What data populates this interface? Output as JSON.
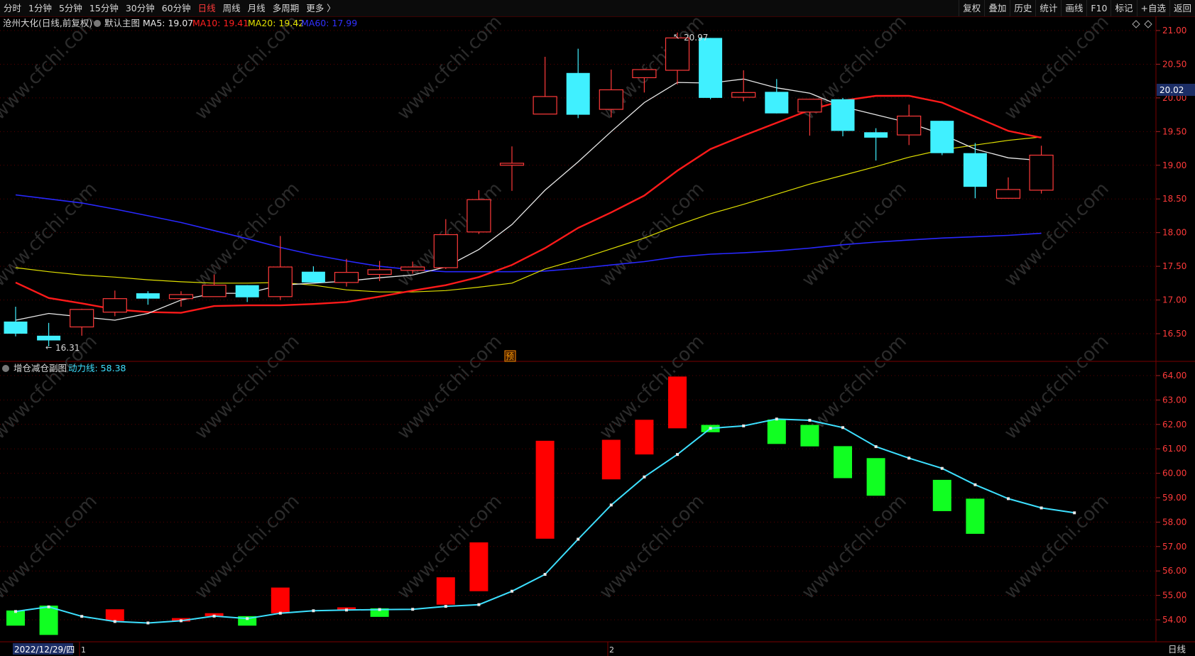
{
  "toolbar": {
    "periods": [
      "分时",
      "1分钟",
      "5分钟",
      "15分钟",
      "30分钟",
      "60分钟",
      "日线",
      "周线",
      "月线",
      "多周期",
      "更多 〉"
    ],
    "active_index": 6,
    "right_buttons": [
      "复权",
      "叠加",
      "历史",
      "统计",
      "画线",
      "F10",
      "标记",
      "+自选",
      "返回"
    ]
  },
  "main_chart": {
    "stock_title": "沧州大化(日线,前复权)",
    "indicator_name": "默认主图",
    "ma": [
      {
        "label": "MA5: 19.07",
        "color": "#e8e8e8"
      },
      {
        "label": "MA10: 19.41",
        "color": "#ff2020"
      },
      {
        "label": "MA20: 19.42",
        "color": "#e0e000"
      },
      {
        "label": "MA60: 17.99",
        "color": "#2020ff"
      }
    ],
    "price_ticks": [
      "21.00",
      "20.50",
      "20.00",
      "19.50",
      "19.00",
      "18.50",
      "18.00",
      "17.50",
      "17.00",
      "16.50"
    ],
    "current_price": "20.02",
    "high_marker": "20.97",
    "low_marker": "16.31",
    "pre_marker": "预"
  },
  "sub_chart": {
    "title": "增仓减仓副图",
    "line_label": "动力线: 58.38",
    "line_color": "#3de0ff",
    "ticks": [
      "64.00",
      "63.00",
      "62.00",
      "61.00",
      "60.00",
      "59.00",
      "58.00",
      "57.00",
      "56.00",
      "55.00",
      "54.00"
    ]
  },
  "statusbar": {
    "date": "2022/12/29/四",
    "marker1": "1",
    "marker2": "2",
    "period": "日线"
  },
  "watermark": "www.cfchi.com",
  "chart_data": [
    {
      "type": "candlestick",
      "title": "沧州大化(日线,前复权)",
      "ylim": [
        16.25,
        21.1
      ],
      "candles": [
        {
          "o": 16.68,
          "h": 16.9,
          "l": 16.46,
          "c": 16.5
        },
        {
          "o": 16.47,
          "h": 16.66,
          "l": 16.31,
          "c": 16.4
        },
        {
          "o": 16.6,
          "h": 16.87,
          "l": 16.47,
          "c": 16.86
        },
        {
          "o": 16.82,
          "h": 17.14,
          "l": 16.76,
          "c": 17.02
        },
        {
          "o": 17.1,
          "h": 17.13,
          "l": 16.93,
          "c": 17.02
        },
        {
          "o": 17.02,
          "h": 17.13,
          "l": 16.9,
          "c": 17.08
        },
        {
          "o": 17.05,
          "h": 17.38,
          "l": 17.05,
          "c": 17.22
        },
        {
          "o": 17.22,
          "h": 17.22,
          "l": 16.97,
          "c": 17.04
        },
        {
          "o": 17.05,
          "h": 17.95,
          "l": 17.0,
          "c": 17.49
        },
        {
          "o": 17.42,
          "h": 17.5,
          "l": 17.28,
          "c": 17.26
        },
        {
          "o": 17.26,
          "h": 17.61,
          "l": 17.2,
          "c": 17.41
        },
        {
          "o": 17.38,
          "h": 17.58,
          "l": 17.28,
          "c": 17.45
        },
        {
          "o": 17.44,
          "h": 17.57,
          "l": 17.39,
          "c": 17.49
        },
        {
          "o": 17.48,
          "h": 18.2,
          "l": 17.46,
          "c": 17.97
        },
        {
          "o": 18.01,
          "h": 18.63,
          "l": 17.98,
          "c": 18.49
        },
        {
          "o": 19.0,
          "h": 19.28,
          "l": 18.62,
          "c": 19.03
        },
        {
          "o": 19.76,
          "h": 20.61,
          "l": 19.76,
          "c": 20.02
        },
        {
          "o": 20.37,
          "h": 20.73,
          "l": 19.7,
          "c": 19.75
        },
        {
          "o": 19.83,
          "h": 20.42,
          "l": 19.71,
          "c": 20.12
        },
        {
          "o": 20.3,
          "h": 20.42,
          "l": 20.08,
          "c": 20.42
        },
        {
          "o": 20.41,
          "h": 20.97,
          "l": 20.2,
          "c": 20.89
        },
        {
          "o": 20.89,
          "h": 20.89,
          "l": 19.98,
          "c": 20.0
        },
        {
          "o": 20.01,
          "h": 20.41,
          "l": 19.95,
          "c": 20.08
        },
        {
          "o": 20.09,
          "h": 20.28,
          "l": 19.77,
          "c": 19.77
        },
        {
          "o": 19.79,
          "h": 19.96,
          "l": 19.44,
          "c": 19.98
        },
        {
          "o": 19.98,
          "h": 20.0,
          "l": 19.43,
          "c": 19.51
        },
        {
          "o": 19.49,
          "h": 19.55,
          "l": 19.07,
          "c": 19.41
        },
        {
          "o": 19.45,
          "h": 19.9,
          "l": 19.3,
          "c": 19.73
        },
        {
          "o": 19.66,
          "h": 19.66,
          "l": 19.15,
          "c": 19.18
        },
        {
          "o": 19.18,
          "h": 19.33,
          "l": 18.51,
          "c": 18.68
        },
        {
          "o": 18.51,
          "h": 18.82,
          "l": 18.51,
          "c": 18.64
        },
        {
          "o": 18.63,
          "h": 19.29,
          "l": 18.58,
          "c": 19.15
        }
      ],
      "ma5": [
        16.7,
        16.8,
        16.75,
        16.7,
        16.8,
        17.0,
        17.1,
        17.1,
        17.22,
        17.25,
        17.28,
        17.33,
        17.37,
        17.49,
        17.75,
        18.12,
        18.63,
        19.05,
        19.5,
        19.93,
        20.23,
        20.22,
        20.28,
        20.15,
        20.07,
        19.87,
        19.75,
        19.63,
        19.46,
        19.24,
        19.11,
        19.07
      ],
      "ma10": [
        17.26,
        17.03,
        16.95,
        16.86,
        16.82,
        16.81,
        16.91,
        16.92,
        16.92,
        16.94,
        16.97,
        17.05,
        17.14,
        17.22,
        17.34,
        17.52,
        17.77,
        18.07,
        18.3,
        18.55,
        18.92,
        19.24,
        19.44,
        19.63,
        19.82,
        19.96,
        20.03,
        20.03,
        19.93,
        19.72,
        19.51,
        19.41
      ],
      "ma20": [
        17.48,
        17.42,
        17.37,
        17.34,
        17.3,
        17.27,
        17.25,
        17.25,
        17.26,
        17.22,
        17.15,
        17.12,
        17.12,
        17.14,
        17.19,
        17.25,
        17.46,
        17.6,
        17.76,
        17.92,
        18.11,
        18.28,
        18.42,
        18.57,
        18.72,
        18.85,
        18.98,
        19.12,
        19.23,
        19.3,
        19.37,
        19.42
      ],
      "ma60": [
        18.56,
        18.5,
        18.44,
        18.35,
        18.25,
        18.15,
        18.03,
        17.91,
        17.78,
        17.67,
        17.58,
        17.5,
        17.45,
        17.42,
        17.42,
        17.42,
        17.43,
        17.47,
        17.52,
        17.57,
        17.64,
        17.68,
        17.7,
        17.73,
        17.77,
        17.82,
        17.86,
        17.89,
        17.92,
        17.94,
        17.96,
        17.99
      ]
    },
    {
      "type": "bar",
      "title": "增仓减仓副图",
      "ylim": [
        53.6,
        64.3
      ],
      "series": [
        {
          "name": "动力线",
          "values": [
            54.34,
            54.53,
            54.14,
            53.93,
            53.87,
            53.96,
            54.15,
            54.05,
            54.27,
            54.37,
            54.4,
            54.42,
            54.43,
            54.55,
            54.62,
            55.17,
            55.86,
            57.3,
            58.7,
            59.85,
            60.77,
            61.84,
            61.94,
            62.22,
            62.17,
            61.87,
            61.09,
            60.62,
            60.2,
            59.53,
            58.96,
            58.58,
            58.38
          ]
        }
      ],
      "bars": [
        {
          "from": 54.38,
          "to": 53.76,
          "color": "green"
        },
        {
          "from": 54.58,
          "to": 53.38,
          "color": "green"
        },
        null,
        {
          "from": 54.43,
          "to": 53.95,
          "color": "red"
        },
        null,
        {
          "from": 54.07,
          "to": 53.93,
          "color": "red"
        },
        {
          "from": 54.27,
          "to": 54.15,
          "color": "red"
        },
        {
          "from": 54.15,
          "to": 53.76,
          "color": "green"
        },
        {
          "from": 55.32,
          "to": 54.27,
          "color": "red"
        },
        null,
        {
          "from": 54.51,
          "to": 54.4,
          "color": "red"
        },
        {
          "from": 54.47,
          "to": 54.12,
          "color": "green"
        },
        null,
        {
          "from": 55.74,
          "to": 54.62,
          "color": "red"
        },
        {
          "from": 57.17,
          "to": 55.17,
          "color": "red"
        },
        null,
        {
          "from": 61.33,
          "to": 57.32,
          "color": "red"
        },
        null,
        {
          "from": 61.37,
          "to": 59.75,
          "color": "red"
        },
        {
          "from": 62.19,
          "to": 60.77,
          "color": "red"
        },
        {
          "from": 63.96,
          "to": 61.84,
          "color": "red"
        },
        {
          "from": 61.98,
          "to": 61.68,
          "color": "green"
        },
        null,
        {
          "from": 62.2,
          "to": 61.2,
          "color": "green"
        },
        {
          "from": 61.98,
          "to": 61.1,
          "color": "green"
        },
        {
          "from": 61.11,
          "to": 59.8,
          "color": "green"
        },
        {
          "from": 60.62,
          "to": 59.08,
          "color": "green"
        },
        null,
        {
          "from": 59.73,
          "to": 58.45,
          "color": "green"
        },
        {
          "from": 58.96,
          "to": 57.52,
          "color": "green"
        }
      ]
    }
  ]
}
